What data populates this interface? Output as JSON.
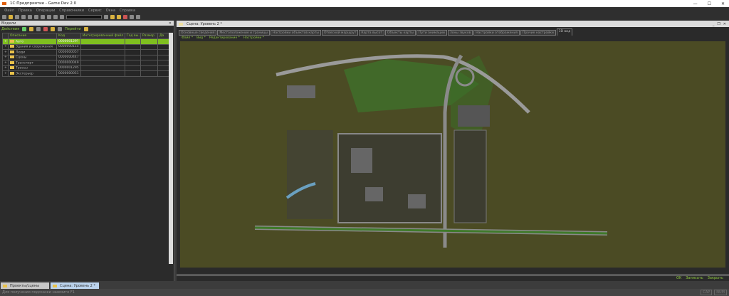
{
  "app": {
    "title": "1С:Предприятие - Game Dev 2.0"
  },
  "menu": [
    "Файл",
    "Правка",
    "Операции",
    "Справочники",
    "Сервис",
    "Окна",
    "Справка"
  ],
  "left_panel": {
    "title": "Модели",
    "actions_label": "Действия",
    "goto_label": "Перейти",
    "columns": [
      "Описание",
      "Код",
      "Интегрированный файл",
      "Год вы...",
      "Размер",
      "Да"
    ],
    "rows": [
      {
        "name": "Авто",
        "code": "000000129?"
      },
      {
        "name": "Здания и сооружения",
        "code": "0000000115"
      },
      {
        "name": "Люди",
        "code": "0000000057"
      },
      {
        "name": "Сцены",
        "code": "0000000447"
      },
      {
        "name": "Транспорт",
        "code": "0000000049"
      },
      {
        "name": "Трассы",
        "code": "0000001295"
      },
      {
        "name": "Экстерьер",
        "code": "0000000051"
      }
    ]
  },
  "scene_window": {
    "title": "Сцена: Уровень 2 *",
    "tabs": [
      "Основные сведения",
      "Местоположение и границы",
      "Настройки объектов карты",
      "Отвесной маршрут",
      "Карта высот",
      "Объекты карты",
      "Пути анимации",
      "Зоны звуков",
      "Настройки отображения",
      "Прочие настройки",
      "3D вид"
    ],
    "active_tab": "3D вид",
    "submenu": [
      "Файл *",
      "Вид *",
      "Редактирование *",
      "Настройки *"
    ],
    "buttons": [
      "OK",
      "Записать",
      "Закрыть"
    ]
  },
  "taskbar": [
    "Проекты/сцены",
    "Сцена: Уровень 2 *"
  ],
  "status": {
    "hint": "Для получения подсказки нажмите F1",
    "indicators": [
      "CAP",
      "NUM"
    ]
  },
  "colors": {
    "accent": "#8dc63f",
    "terrain": "#4a4a22"
  }
}
